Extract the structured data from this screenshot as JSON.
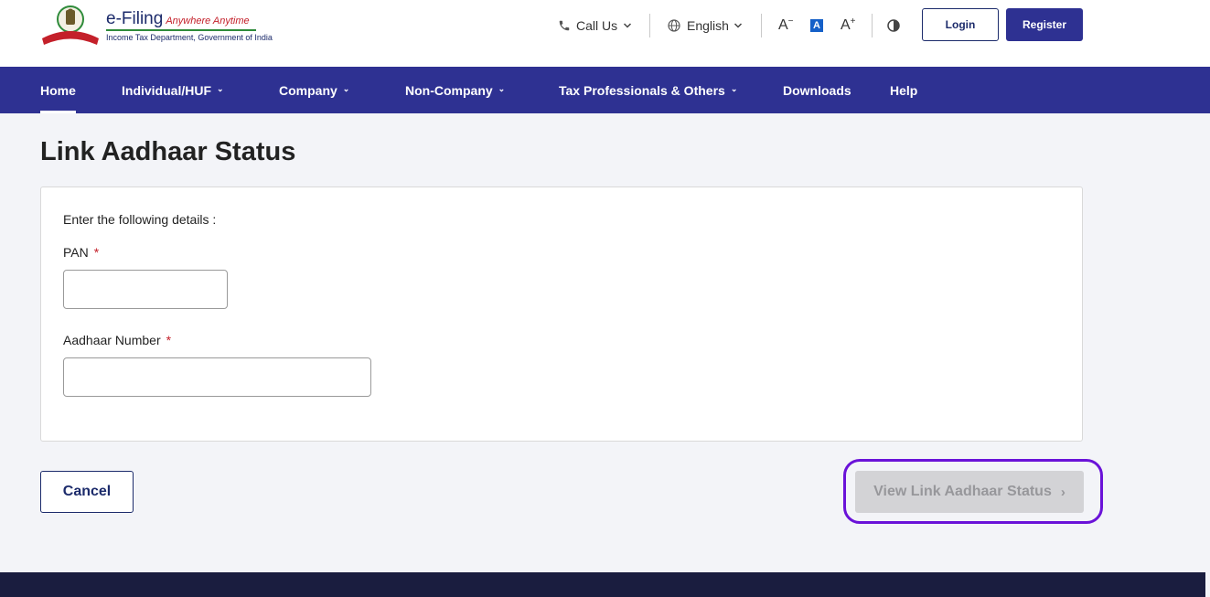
{
  "brand": {
    "title": "e-Filing",
    "tagline": "Anywhere Anytime",
    "subtitle": "Income Tax Department, Government of India"
  },
  "utility": {
    "call_us": "Call Us",
    "language": "English",
    "font_decrease": "A",
    "font_default": "A",
    "font_increase": "A",
    "login": "Login",
    "register": "Register"
  },
  "nav": {
    "items": [
      {
        "label": "Home",
        "has_menu": false
      },
      {
        "label": "Individual/HUF",
        "has_menu": true
      },
      {
        "label": "Company",
        "has_menu": true
      },
      {
        "label": "Non-Company",
        "has_menu": true
      },
      {
        "label": "Tax Professionals & Others",
        "has_menu": true
      },
      {
        "label": "Downloads",
        "has_menu": false
      },
      {
        "label": "Help",
        "has_menu": false
      }
    ],
    "active": "Home"
  },
  "page": {
    "title": "Link Aadhaar Status"
  },
  "form": {
    "intro": "Enter the following details :",
    "pan_label": "PAN",
    "pan_value": "",
    "aadhaar_label": "Aadhaar Number",
    "aadhaar_value": "",
    "required_mark": "*"
  },
  "actions": {
    "cancel": "Cancel",
    "submit": "View Link Aadhaar Status",
    "submit_arrow": "›",
    "submit_disabled": true
  },
  "colors": {
    "nav_bg": "#2e3192",
    "brand_navy": "#1c2b6b",
    "required_red": "#c4202a",
    "highlight_ring": "#6a12d8",
    "footer_bg": "#1a1d3f",
    "page_bg": "#f3f4f8"
  }
}
